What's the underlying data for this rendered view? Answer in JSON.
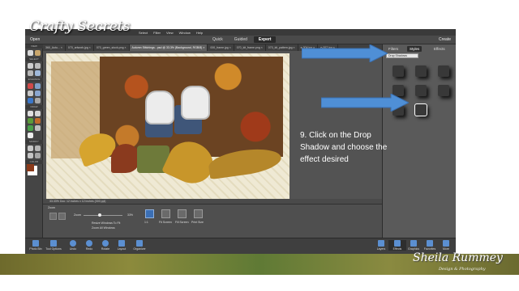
{
  "logo": "Crafty Secrets",
  "menu": {
    "items": [
      "Select",
      "Filter",
      "View",
      "Window",
      "Help"
    ]
  },
  "modebar": {
    "open_label": "Open",
    "modes": [
      "Quick",
      "Guided",
      "Expert"
    ],
    "active_mode": "Expert",
    "create_label": "Create"
  },
  "tabs": [
    {
      "label": "360_Autu... ×"
    },
    {
      "label": "070_artwork.jpg ×"
    },
    {
      "label": "070_green_stock.png ×"
    },
    {
      "label": "Autumn Stitchings - psd @ 33.3% (Background, RGB/8) ×"
    },
    {
      "label": "000_frame.jpg ×"
    },
    {
      "label": "070_kit_frame.png ×"
    },
    {
      "label": "070_kit_pattern.jpg ×"
    },
    {
      "label": "e-004.jpg ×"
    },
    {
      "label": "e-002.jpg ×"
    }
  ],
  "toolbox": {
    "sections": [
      "VIEW",
      "SELECT",
      "ENHANCE",
      "DRAW",
      "MODIFY",
      "COLOR"
    ]
  },
  "panel": {
    "tabs": [
      "Filters",
      "Styles",
      "Effects"
    ],
    "active_tab": "Styles",
    "dropdown": "Drop Shadows"
  },
  "instruction": "9. Click on the Drop Shadow and choose the effect desired",
  "status": "33.33%   Doc: 12 inches x 12 inches (300 ppi)",
  "options": {
    "zoom_label": "Zoom",
    "zoom_value": "33%",
    "resize_windows": "Resize Windows To Fit",
    "zoom_all_windows": "Zoom All Windows",
    "buttons": [
      "1:1",
      "Fit Screen",
      "Fill Screen",
      "Print Size"
    ]
  },
  "taskbar": {
    "left": [
      "Photo Bin",
      "Tool Options",
      "Undo",
      "Redo",
      "Rotate",
      "Layout",
      "Organizer"
    ],
    "right": [
      "Layers",
      "Effects",
      "Graphics",
      "Favorites",
      "More"
    ]
  },
  "signature": "Sheila Rummey",
  "credit": "Design & Photography",
  "colors": {
    "arrow": "#4f8fd6",
    "app_bg": "#535353",
    "accent_panel": "#5a5a5a"
  }
}
